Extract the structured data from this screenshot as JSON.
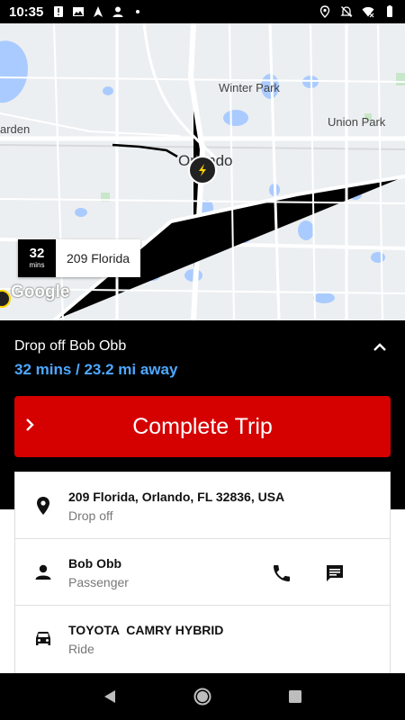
{
  "status_bar": {
    "time": "10:35",
    "left_icons": [
      "alert-icon",
      "image-icon",
      "navigation-icon",
      "person-icon",
      "dot-icon"
    ],
    "right_icons": [
      "location-icon",
      "mute-icon",
      "wifi-icon",
      "battery-icon"
    ]
  },
  "map": {
    "labels": {
      "winter_park": "Winter Park",
      "union_park": "Union Park",
      "garden": "arden",
      "orlando": "Orlando"
    },
    "destination_chip": {
      "mins_value": "32",
      "mins_unit": "mins",
      "name": "209 Florida"
    },
    "attribution": "Google"
  },
  "trip_panel": {
    "title": "Drop off Bob Obb",
    "eta": "32 mins / 23.2 mi away",
    "complete_button_label": "Complete Trip"
  },
  "details": [
    {
      "title": "209 Florida, Orlando, FL 32836, USA",
      "subtitle": "Drop off",
      "icon": "location-pin-icon"
    },
    {
      "title": "Bob Obb",
      "subtitle": "Passenger",
      "icon": "person-icon"
    },
    {
      "title": "TOYOTA  CAMRY HYBRID",
      "subtitle": "Ride",
      "icon": "car-icon"
    }
  ],
  "colors": {
    "accent_blue": "#4ea8ff",
    "complete_red": "#d50000",
    "panel_black": "#000000"
  }
}
